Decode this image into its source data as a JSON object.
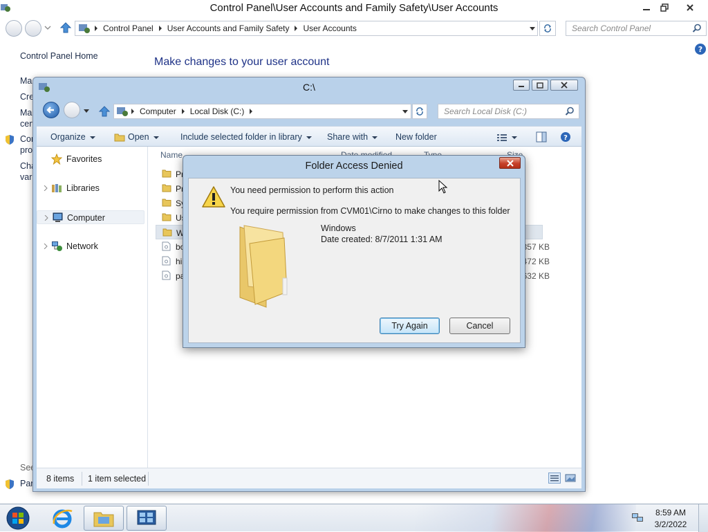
{
  "control_panel": {
    "title": "Control Panel\\User Accounts and Family Safety\\User Accounts",
    "breadcrumbs": [
      "Control Panel",
      "User Accounts and Family Safety",
      "User Accounts"
    ],
    "search_placeholder": "Search Control Panel",
    "sidebar": {
      "home": "Control Panel Home",
      "partial_items": [
        "Ma",
        "Cre",
        "Ma",
        "cert",
        "Cor",
        "pro",
        "Cha",
        "vari"
      ],
      "see_also": "See",
      "bottom_item": "Par"
    },
    "main_heading": "Make changes to your user account"
  },
  "explorer": {
    "title": "C:\\",
    "breadcrumbs": [
      "Computer",
      "Local Disk (C:)"
    ],
    "search_placeholder": "Search Local Disk (C:)",
    "toolbar": {
      "organize": "Organize",
      "open": "Open",
      "include": "Include selected folder in library",
      "share": "Share with",
      "new_folder": "New folder"
    },
    "nav": {
      "favorites": "Favorites",
      "libraries": "Libraries",
      "computer": "Computer",
      "network": "Network"
    },
    "columns": {
      "name": "Name",
      "date": "Date modified",
      "type": "Type",
      "size": "Size"
    },
    "rows": [
      {
        "name": "Pr",
        "kind": "folder",
        "size": ""
      },
      {
        "name": "Pr",
        "kind": "folder",
        "size": ""
      },
      {
        "name": "Sy",
        "kind": "folder",
        "size": ""
      },
      {
        "name": "Us",
        "kind": "folder",
        "size": ""
      },
      {
        "name": "W",
        "kind": "folder",
        "size": ""
      },
      {
        "name": "bo",
        "kind": "file",
        "size": "357 KB"
      },
      {
        "name": "hi",
        "kind": "file",
        "size": "472 KB"
      },
      {
        "name": "pa",
        "kind": "file",
        "size": "632 KB"
      }
    ],
    "status": {
      "count": "8 items",
      "selected": "1 item selected"
    }
  },
  "dialog": {
    "title": "Folder Access Denied",
    "message": "You need permission to perform this action",
    "detail": "You require permission from CVM01\\Cirno to make changes to this folder",
    "folder_name": "Windows",
    "date_created": "Date created: 8/7/2011 1:31 AM",
    "try_again": "Try Again",
    "cancel": "Cancel"
  },
  "taskbar": {
    "time": "8:59 AM",
    "date": "3/2/2022"
  }
}
